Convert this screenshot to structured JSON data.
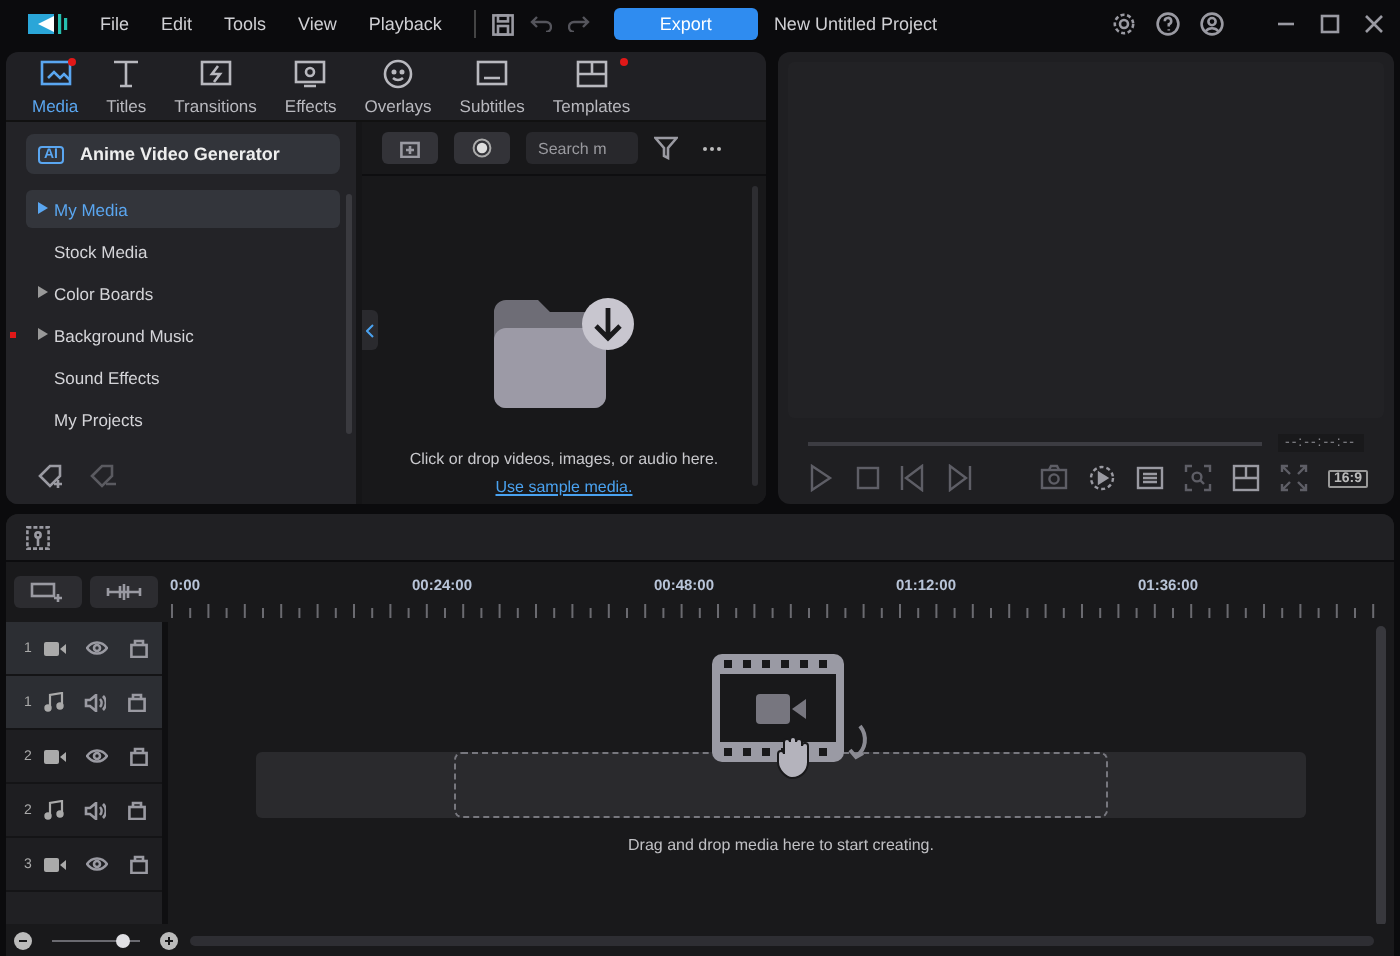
{
  "menu": [
    "File",
    "Edit",
    "Tools",
    "View",
    "Playback"
  ],
  "export_button": "Export",
  "project_title": "New Untitled Project",
  "tabs": [
    {
      "label": "Media",
      "selected": true,
      "badge": true
    },
    {
      "label": "Titles",
      "selected": false,
      "badge": false
    },
    {
      "label": "Transitions",
      "selected": false,
      "badge": false
    },
    {
      "label": "Effects",
      "selected": false,
      "badge": false
    },
    {
      "label": "Overlays",
      "selected": false,
      "badge": false
    },
    {
      "label": "Subtitles",
      "selected": false,
      "badge": false
    },
    {
      "label": "Templates",
      "selected": false,
      "badge": true
    }
  ],
  "generator": {
    "icon_label": "AI",
    "label": "Anime Video Generator"
  },
  "sidebar": {
    "items": [
      {
        "label": "My Media",
        "selected": true,
        "expandable": true,
        "badge": false
      },
      {
        "label": "Stock Media",
        "selected": false,
        "expandable": false,
        "badge": false
      },
      {
        "label": "Color Boards",
        "selected": false,
        "expandable": true,
        "badge": false
      },
      {
        "label": "Background Music",
        "selected": false,
        "expandable": true,
        "badge": true
      },
      {
        "label": "Sound Effects",
        "selected": false,
        "expandable": false,
        "badge": false
      },
      {
        "label": "My Projects",
        "selected": false,
        "expandable": false,
        "badge": false
      }
    ]
  },
  "search": {
    "placeholder": "Search m"
  },
  "drop_area": {
    "text": "Click or drop videos, images, or audio here.",
    "link": "Use sample media."
  },
  "preview": {
    "timecode": "--:--:--:--",
    "aspect": "16:9"
  },
  "timeline": {
    "ruler": [
      "0:00",
      "00:24:00",
      "00:48:00",
      "01:12:00",
      "01:36:00"
    ],
    "tracks": [
      {
        "number": "1",
        "kind": "video",
        "selected": true
      },
      {
        "number": "1",
        "kind": "audio",
        "selected": true
      },
      {
        "number": "2",
        "kind": "video",
        "selected": false
      },
      {
        "number": "2",
        "kind": "audio",
        "selected": false
      },
      {
        "number": "3",
        "kind": "video",
        "selected": false
      }
    ],
    "hint": "Drag and drop media here to start creating."
  },
  "zoom": {
    "level": 0.8
  }
}
